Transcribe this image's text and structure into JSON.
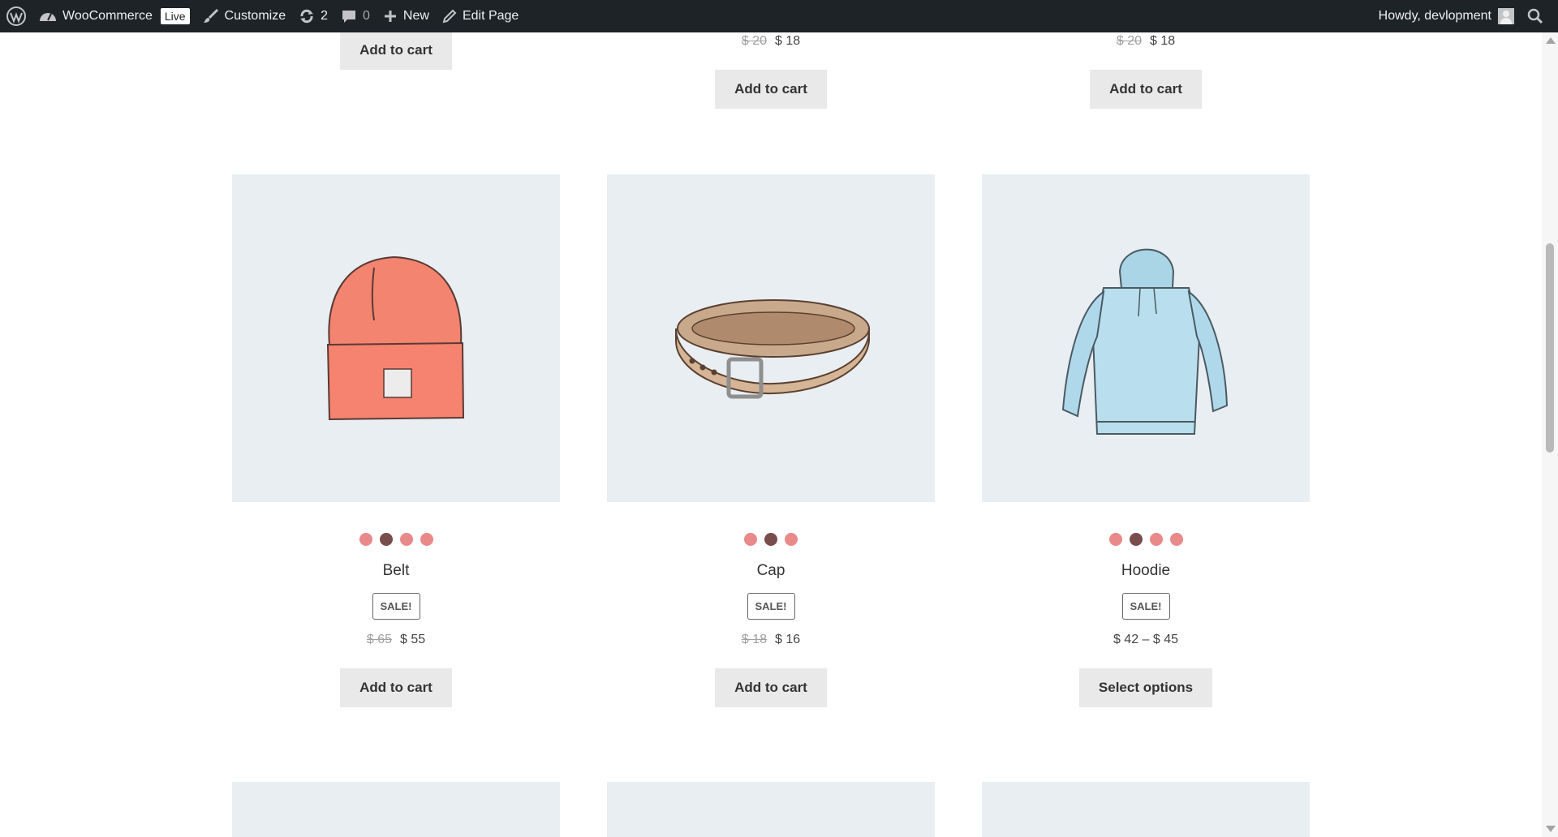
{
  "adminbar": {
    "site_name": "WooCommerce",
    "live_badge": "Live",
    "customize": "Customize",
    "updates_count": "2",
    "comments_count": "0",
    "new_label": "New",
    "edit_page": "Edit Page",
    "greeting": "Howdy, devlopment",
    "icons": [
      "wordpress-icon",
      "dashboard-icon",
      "brush-icon",
      "refresh-icon",
      "comment-icon",
      "plus-icon",
      "pencil-icon",
      "avatar",
      "search-icon"
    ]
  },
  "top_row": [
    {
      "button": "Add to cart"
    },
    {
      "price_old": "$ 20",
      "price_new": "$ 18",
      "button": "Add to cart"
    },
    {
      "price_old": "$ 20",
      "price_new": "$ 18",
      "button": "Add to cart"
    }
  ],
  "products": [
    {
      "title": "Belt",
      "sale_badge": "SALE!",
      "price_old": "$ 65",
      "price_new": "$ 55",
      "button": "Add to cart",
      "image": "beanie-illustration",
      "swatches": [
        "#e9898a",
        "#7a4d4d",
        "#e9898a",
        "#e9898a"
      ]
    },
    {
      "title": "Cap",
      "sale_badge": "SALE!",
      "price_old": "$ 18",
      "price_new": "$ 16",
      "button": "Add to cart",
      "image": "belt-illustration",
      "swatches": [
        "#e9898a",
        "#7a4d4d",
        "#e9898a"
      ]
    },
    {
      "title": "Hoodie",
      "sale_badge": "SALE!",
      "price_range": "$ 42 – $ 45",
      "button": "Select options",
      "image": "hoodie-illustration",
      "swatches": [
        "#e9898a",
        "#7a4d4d",
        "#e9898a",
        "#e9898a"
      ]
    }
  ],
  "colors": {
    "adminbar_bg": "#1d2327",
    "thumb_bg": "#e9eef2",
    "button_bg": "#e9e9ea",
    "swatch_light": "#e9898a",
    "swatch_dark": "#7a4d4d"
  }
}
